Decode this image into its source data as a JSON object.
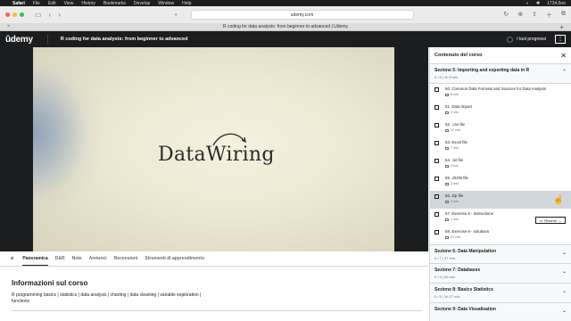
{
  "menubar": {
    "apple": "",
    "items": [
      "Safari",
      "File",
      "Edit",
      "View",
      "History",
      "Bookmarks",
      "Develop",
      "Window",
      "Help"
    ],
    "right": [
      "◐",
      "✱",
      "1734,5ne"
    ]
  },
  "browser": {
    "url": "udemy.com",
    "tab_title": "R coding for data analysts: from beginner to advanced | Udemy"
  },
  "header": {
    "logo": "ûdemy",
    "course_title": "R coding for data analysts: from beginner to advanced",
    "progress_label": "I tuoi progressi",
    "more_icon": "⋮"
  },
  "video": {
    "wordmark": "DataWiring"
  },
  "sidebar": {
    "title": "Contenuto del corso",
    "current_section": {
      "title": "Sezione 5: Importing and exporting data in R",
      "meta": "0 / 8 | 1h 5 min"
    },
    "lectures": [
      {
        "title": "50. Common Data Formats and Sources for Data Analysis",
        "meta": "8 min"
      },
      {
        "title": "51. Data import",
        "meta": "3 min"
      },
      {
        "title": "52. .csv file",
        "meta": "17 min"
      },
      {
        "title": "53. Excel file",
        "meta": "7 min"
      },
      {
        "title": "54. .txt file",
        "meta": "3 min"
      },
      {
        "title": "55. JSON file",
        "meta": "3 min"
      },
      {
        "title": "56. Zip file",
        "meta": "3 min"
      },
      {
        "title": "57. Exercise 9 - instructions",
        "meta": "1 min"
      },
      {
        "title": "58. Exercise 9 - solutions",
        "meta": "21 min"
      }
    ],
    "resources_label": "Risorse",
    "sections": [
      {
        "title": "Sezione 6: Data Manipulation",
        "meta": "0 / 7 | 37 min"
      },
      {
        "title": "Sezione 7: Databases",
        "meta": "0 / 4 | 40 min"
      },
      {
        "title": "Sezione 8: Basics Statistics",
        "meta": "0 / 5 | 1h 27 min"
      },
      {
        "title": "Sezione 9: Data Visualisation",
        "meta": ""
      }
    ]
  },
  "tabs": [
    "Panoramica",
    "D&R",
    "Note",
    "Annunci",
    "Recensioni",
    "Strumenti di apprendimento"
  ],
  "about": {
    "heading": "Informazioni sul corso",
    "text": "R programming basics | statistics | data analysis | charting | data cleaning | variable exploration | functions"
  }
}
